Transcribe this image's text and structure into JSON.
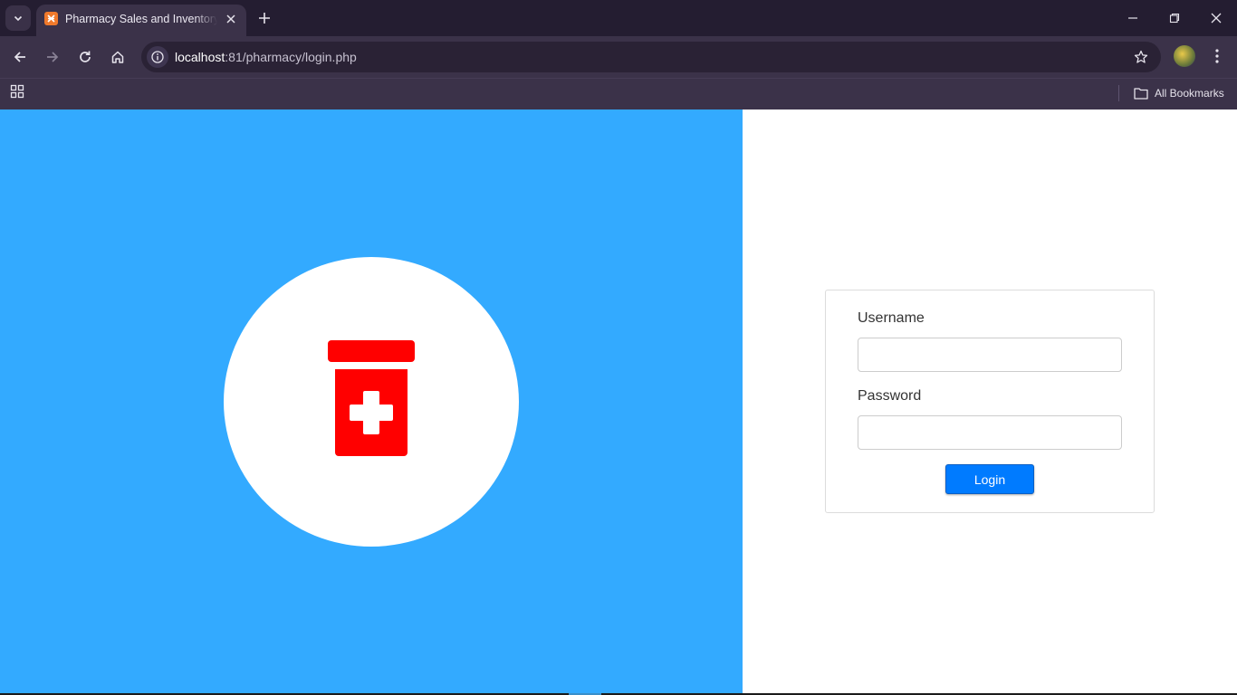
{
  "browser": {
    "tab": {
      "title": "Pharmacy Sales and Inventory System",
      "favicon": "xampp-icon"
    },
    "address": {
      "host": "localhost",
      "port_path": ":81/pharmacy/login.php"
    },
    "bookmarks": {
      "all_bookmarks_label": "All Bookmarks"
    },
    "colors": {
      "tab_strip": "#241d31",
      "toolbar": "#3b3249"
    }
  },
  "page": {
    "colors": {
      "left_panel": "#33aaff",
      "logo": "#ff0000",
      "login_button": "#007bff"
    },
    "logo_icon": "medicine-bottle-cross-icon",
    "login_form": {
      "username_label": "Username",
      "username_value": "",
      "password_label": "Password",
      "password_value": "",
      "login_label": "Login"
    }
  }
}
